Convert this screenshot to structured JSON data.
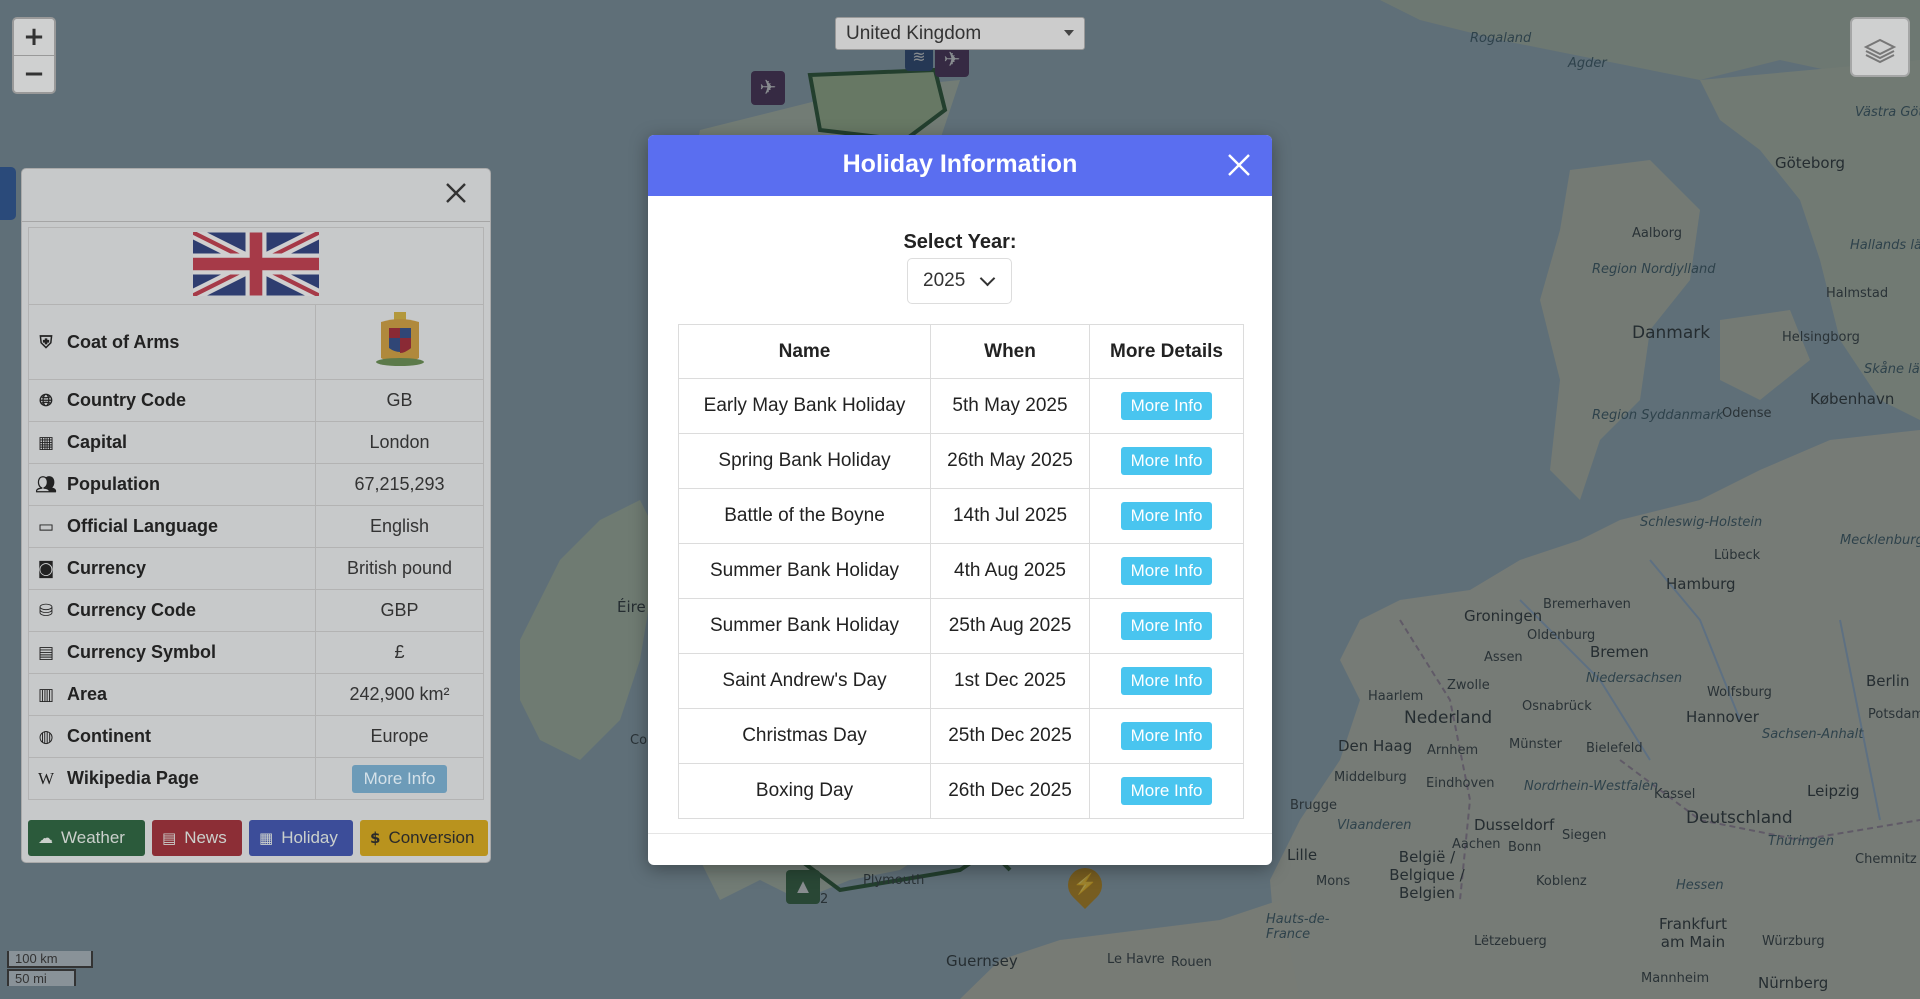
{
  "map": {
    "labels": {
      "rogaland": "Rogaland",
      "agder": "Agder",
      "vastra_gotaland": "Västra Götalands län",
      "goteborg": "Göteborg",
      "aalborg": "Aalborg",
      "region_nordjylland": "Region Nordjylland",
      "hallands_lan": "Hallands län",
      "halmstad": "Halmstad",
      "danmark": "Danmark",
      "helsingborg": "Helsingborg",
      "skane_lan": "Skåne län",
      "kobenhavn": "København",
      "region_syddanmark": "Region Syddanmark",
      "odense": "Odense",
      "schleswig_holstein": "Schleswig-Holstein",
      "lubeck": "Lübeck",
      "mecklenburg": "Mecklenburg-Vorpommern",
      "hamburg": "Hamburg",
      "bremerhaven": "Bremerhaven",
      "groningen": "Groningen",
      "oldenburg": "Oldenburg",
      "bremen": "Bremen",
      "assen": "Assen",
      "niedersachsen": "Niedersachsen",
      "berlin": "Berlin",
      "potsdam": "Potsdam",
      "haarlem": "Haarlem",
      "zwolle": "Zwolle",
      "nederland": "Nederland",
      "osnabruck": "Osnabrück",
      "wolfsburg": "Wolfsburg",
      "hannover": "Hannover",
      "den_haag": "Den Haag",
      "arnhem": "Arnhem",
      "munster": "Münster",
      "bielefeld": "Bielefeld",
      "sachsen_anhalt": "Sachsen-Anhalt",
      "middelburg": "Middelburg",
      "eindhoven": "Eindhoven",
      "nordrhein": "Nordrhein-Westfalen",
      "kassel": "Kassel",
      "leipzig": "Leipzig",
      "brugge": "Brugge",
      "vlaanderen": "Vlaanderen",
      "dusseldorf": "Dusseldorf",
      "deutschland": "Deutschland",
      "lille": "Lille",
      "aachen": "Aachen",
      "bonn": "Bonn",
      "siegen": "Siegen",
      "thuringen": "Thüringen",
      "belgie": "België / Belgique / Belgien",
      "mons": "Mons",
      "koblenz": "Koblenz",
      "chemnitz": "Chemnitz",
      "hessen": "Hessen",
      "hauts_de_france": "Hauts-de-France",
      "frankfurt": "Frankfurt am Main",
      "letzebuerg": "Lëtzebuerg",
      "wurzburg": "Würzburg",
      "mannheim": "Mannheim",
      "nurnberg": "Nürnberg",
      "plymouth": "Plymouth",
      "guernsey": "Guernsey",
      "le_havre": "Le Havre",
      "rouen": "Rouen",
      "eire": "Éire",
      "co": "Co"
    },
    "cluster_count": "2"
  },
  "country_select": {
    "value": "United Kingdom"
  },
  "zoom": {
    "in": "+",
    "out": "−"
  },
  "info_panel": {
    "rows": [
      {
        "label": "Coat of Arms"
      },
      {
        "label": "Country Code",
        "value": "GB"
      },
      {
        "label": "Capital",
        "value": "London"
      },
      {
        "label": "Population",
        "value": "67,215,293"
      },
      {
        "label": "Official Language",
        "value": "English"
      },
      {
        "label": "Currency",
        "value": "British pound"
      },
      {
        "label": "Currency Code",
        "value": "GBP"
      },
      {
        "label": "Currency Symbol",
        "value": "£"
      },
      {
        "label": "Area",
        "value": "242,900 km²"
      },
      {
        "label": "Continent",
        "value": "Europe"
      },
      {
        "label": "Wikipedia Page",
        "value": "More Info"
      }
    ],
    "buttons": {
      "weather": "Weather",
      "news": "News",
      "holiday": "Holiday",
      "conversion": "Conversion"
    },
    "icons": {
      "coat": "shield-icon",
      "code": "globe-icon",
      "capital": "city-icon",
      "population": "people-icon",
      "language": "language-icon",
      "currency": "money-bill-icon",
      "currency_code": "coins-icon",
      "symbol": "money-check-icon",
      "area": "map-icon",
      "continent": "earth-icon",
      "wikipedia": "wikipedia-icon"
    }
  },
  "scale": {
    "km": "100 km",
    "mi": "50 mi"
  },
  "modal": {
    "title": "Holiday Information",
    "year_label": "Select Year:",
    "year_value": "2025",
    "headers": [
      "Name",
      "When",
      "More Details"
    ],
    "rows": [
      {
        "name": "Early May Bank Holiday",
        "when": "5th May 2025",
        "action": "More Info"
      },
      {
        "name": "Spring Bank Holiday",
        "when": "26th May 2025",
        "action": "More Info"
      },
      {
        "name": "Battle of the Boyne",
        "when": "14th Jul 2025",
        "action": "More Info"
      },
      {
        "name": "Summer Bank Holiday",
        "when": "4th Aug 2025",
        "action": "More Info"
      },
      {
        "name": "Summer Bank Holiday",
        "when": "25th Aug 2025",
        "action": "More Info"
      },
      {
        "name": "Saint Andrew's Day",
        "when": "1st Dec 2025",
        "action": "More Info"
      },
      {
        "name": "Christmas Day",
        "when": "25th Dec 2025",
        "action": "More Info"
      },
      {
        "name": "Boxing Day",
        "when": "26th Dec 2025",
        "action": "More Info"
      }
    ]
  },
  "colors": {
    "modal_header": "#5a6ef0",
    "more_info_button": "#49c5ef",
    "weather": "#2b5a3b",
    "news": "#8c2e36",
    "holiday": "#3c4d99",
    "conversion": "#b9931e"
  }
}
